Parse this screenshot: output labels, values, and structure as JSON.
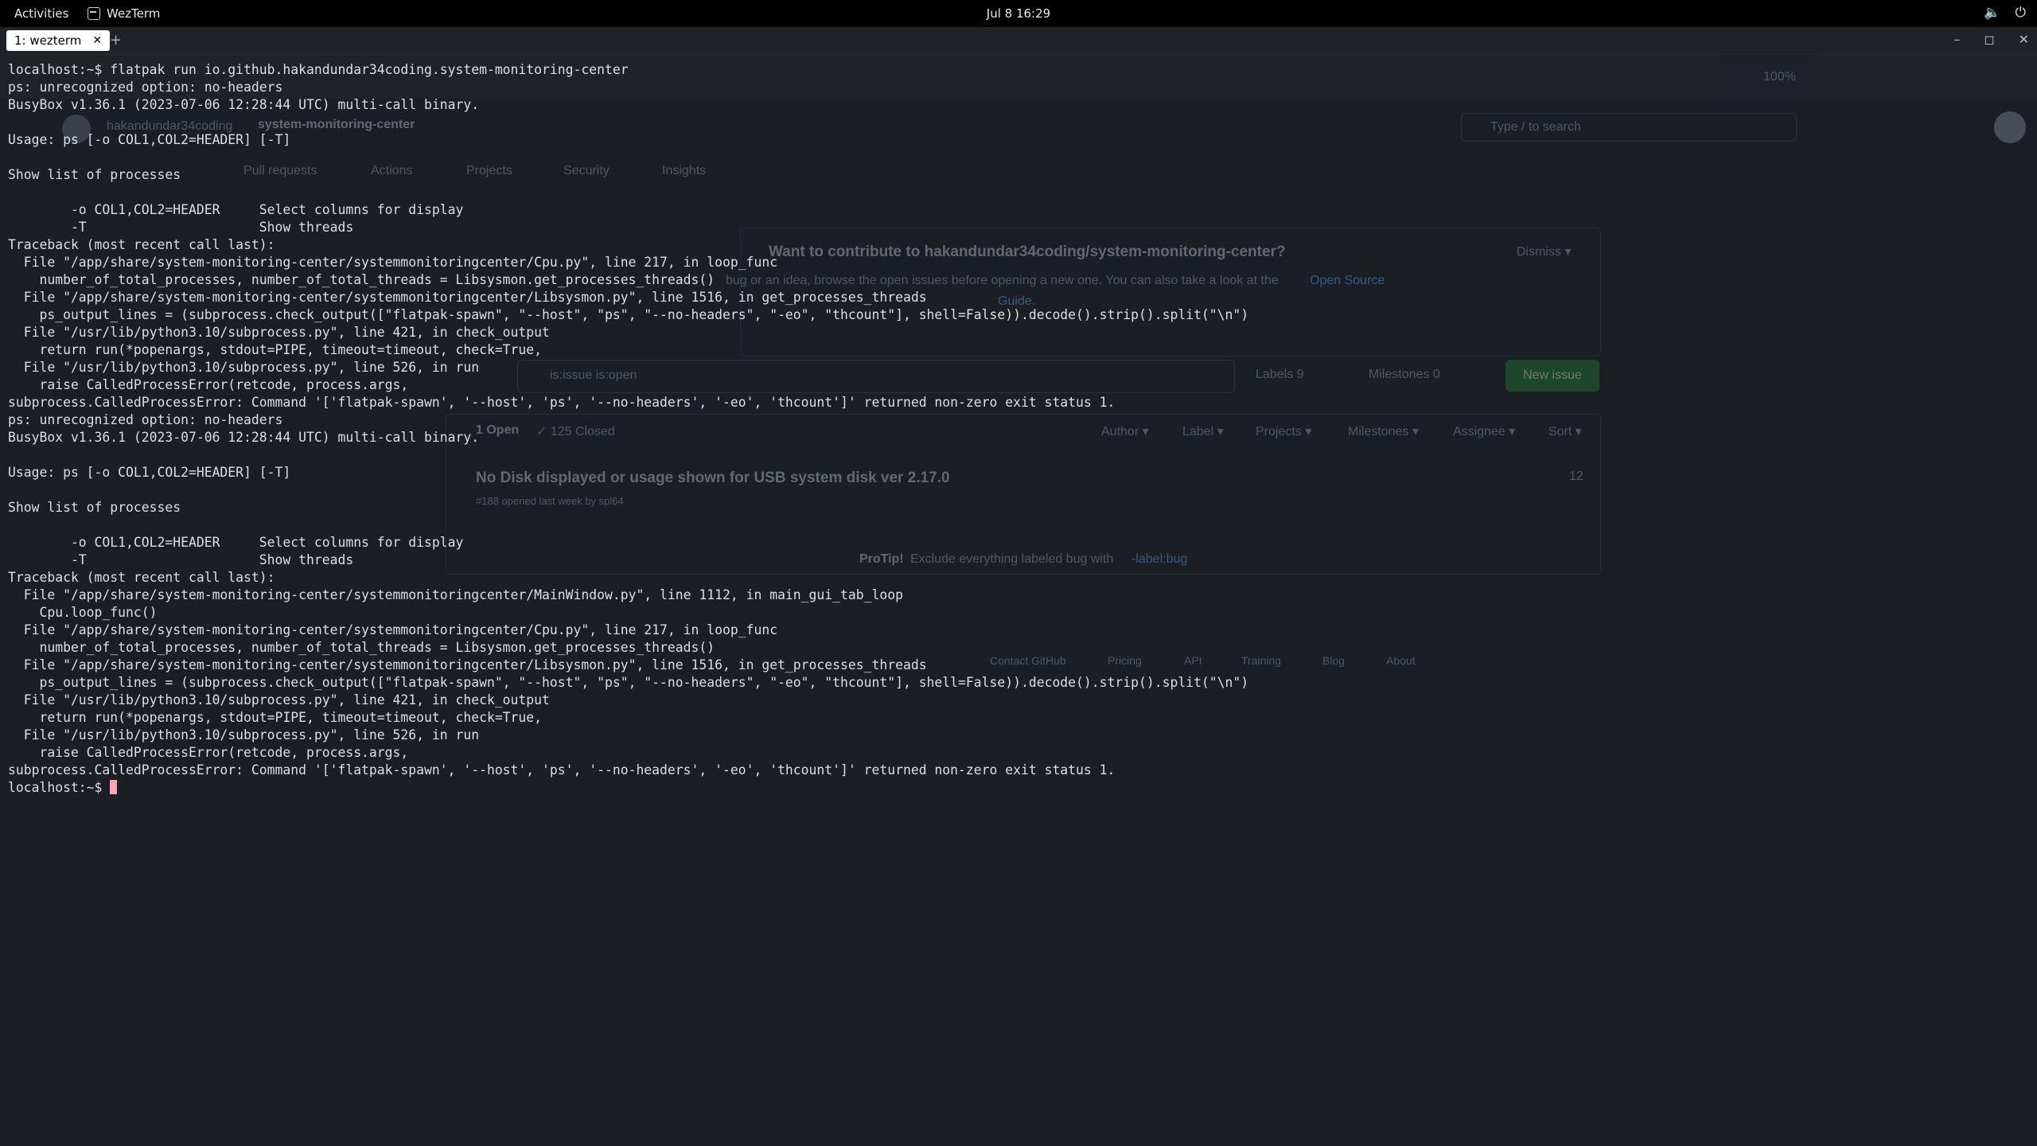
{
  "topbar": {
    "activities": "Activities",
    "app_name": "WezTerm",
    "clock": "Jul 8  16:29",
    "tray": {
      "volume_icon": "speaker-icon",
      "power_icon": "power-icon"
    }
  },
  "window": {
    "tab_label": "1: wezterm",
    "tab_close": "✕",
    "new_tab": "+",
    "minimize": "–",
    "maximize": "◻",
    "close": "✕"
  },
  "ghost": {
    "repo_owner": "hakandundar34coding",
    "repo_name": "system-monitoring-center",
    "search_placeholder": "Type / to search",
    "tabs": [
      "Pull requests",
      "Actions",
      "Projects",
      "Security",
      "Insights"
    ],
    "banner_title": "Want to contribute to hakandundar34coding/system-monitoring-center?",
    "banner_text": "bug or an idea, browse the open issues before opening a new one. You can also take a look at the",
    "banner_link": "Open Source",
    "banner_link2": "Guide.",
    "dismiss": "Dismiss ▾",
    "filter_placeholder": "is:issue is:open",
    "labels": "Labels  9",
    "milestones": "Milestones  0",
    "new_issue": "New issue",
    "open_count": "1 Open",
    "closed_count": "✓ 125 Closed",
    "filters": [
      "Author ▾",
      "Label ▾",
      "Projects ▾",
      "Milestones ▾",
      "Assignee ▾",
      "Sort ▾"
    ],
    "issue_title": "No Disk displayed or usage shown for USB system disk ver 2.17.0",
    "issue_meta": "#188 opened last week by spl64",
    "issue_comments": "12",
    "protip_label": "ProTip!",
    "protip_text": "Exclude everything labeled  bug  with",
    "protip_link": "-label:bug",
    "footer": [
      "Contact GitHub",
      "Pricing",
      "API",
      "Training",
      "Blog",
      "About"
    ],
    "zoom": "100%"
  },
  "terminal": {
    "lines": [
      "localhost:~$ flatpak run io.github.hakandundar34coding.system-monitoring-center",
      "ps: unrecognized option: no-headers",
      "BusyBox v1.36.1 (2023-07-06 12:28:44 UTC) multi-call binary.",
      "",
      "Usage: ps [-o COL1,COL2=HEADER] [-T]",
      "",
      "Show list of processes",
      "",
      "        -o COL1,COL2=HEADER     Select columns for display",
      "        -T                      Show threads",
      "Traceback (most recent call last):",
      "  File \"/app/share/system-monitoring-center/systemmonitoringcenter/Cpu.py\", line 217, in loop_func",
      "    number_of_total_processes, number_of_total_threads = Libsysmon.get_processes_threads()",
      "  File \"/app/share/system-monitoring-center/systemmonitoringcenter/Libsysmon.py\", line 1516, in get_processes_threads",
      "    ps_output_lines = (subprocess.check_output([\"flatpak-spawn\", \"--host\", \"ps\", \"--no-headers\", \"-eo\", \"thcount\"], shell=False)).decode().strip().split(\"\\n\")",
      "  File \"/usr/lib/python3.10/subprocess.py\", line 421, in check_output",
      "    return run(*popenargs, stdout=PIPE, timeout=timeout, check=True,",
      "  File \"/usr/lib/python3.10/subprocess.py\", line 526, in run",
      "    raise CalledProcessError(retcode, process.args,",
      "subprocess.CalledProcessError: Command '['flatpak-spawn', '--host', 'ps', '--no-headers', '-eo', 'thcount']' returned non-zero exit status 1.",
      "ps: unrecognized option: no-headers",
      "BusyBox v1.36.1 (2023-07-06 12:28:44 UTC) multi-call binary.",
      "",
      "Usage: ps [-o COL1,COL2=HEADER] [-T]",
      "",
      "Show list of processes",
      "",
      "        -o COL1,COL2=HEADER     Select columns for display",
      "        -T                      Show threads",
      "Traceback (most recent call last):",
      "  File \"/app/share/system-monitoring-center/systemmonitoringcenter/MainWindow.py\", line 1112, in main_gui_tab_loop",
      "    Cpu.loop_func()",
      "  File \"/app/share/system-monitoring-center/systemmonitoringcenter/Cpu.py\", line 217, in loop_func",
      "    number_of_total_processes, number_of_total_threads = Libsysmon.get_processes_threads()",
      "  File \"/app/share/system-monitoring-center/systemmonitoringcenter/Libsysmon.py\", line 1516, in get_processes_threads",
      "    ps_output_lines = (subprocess.check_output([\"flatpak-spawn\", \"--host\", \"ps\", \"--no-headers\", \"-eo\", \"thcount\"], shell=False)).decode().strip().split(\"\\n\")",
      "  File \"/usr/lib/python3.10/subprocess.py\", line 421, in check_output",
      "    return run(*popenargs, stdout=PIPE, timeout=timeout, check=True,",
      "  File \"/usr/lib/python3.10/subprocess.py\", line 526, in run",
      "    raise CalledProcessError(retcode, process.args,",
      "subprocess.CalledProcessError: Command '['flatpak-spawn', '--host', 'ps', '--no-headers', '-eo', 'thcount']' returned non-zero exit status 1."
    ],
    "prompt": "localhost:~$ "
  }
}
